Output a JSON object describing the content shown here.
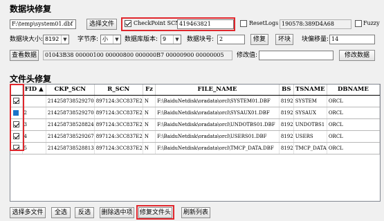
{
  "data_block": {
    "title": "数据块修复",
    "file_path": "F:\\temp\\system01.dbf",
    "select_file_label": "选择文件",
    "checkpoint_scn_label": "CheckPoint SCN",
    "checkpoint_scn_value": "419463821",
    "resetlogs_label": "ResetLogs",
    "resetlogs_value": "190578:389D4A68",
    "fuzzy_label": "Fuzzy",
    "block_size_label": "数据块大小:",
    "block_size_value": "8192",
    "byte_order_label": "字节序:",
    "byte_order_value": "小",
    "db_version_label": "数据库版本:",
    "db_version_value": "9",
    "block_no_label": "数据块号:",
    "block_no_value": "2",
    "repair_label": "修复",
    "bad_block_label": "坏块",
    "block_offset_label": "块偏移量:",
    "block_offset_value": "14",
    "view_data_label": "查看数据",
    "data_hex": "01043B38 00000100 00000800 000000B7 00000900 00000005",
    "modify_value_label": "修改值:",
    "modify_value": "",
    "modify_data_label": "修改数据"
  },
  "file_header": {
    "title": "文件头修复",
    "columns": [
      "FID",
      "CKP_SCN",
      "R_SCN",
      "Fz",
      "FILE_NAME",
      "BS",
      "TSNAME",
      "DBNAME"
    ],
    "rows": [
      {
        "checked": true,
        "fid": "",
        "ckp_scn": "214258738529270",
        "r_scn": "897124:3CC837E2",
        "fz": "N",
        "file_name": "F:\\BaiduNetdisk\\oradata\\orcl\\SYSTEM01.DBF",
        "bs": "8192",
        "tsname": "SYSTEM",
        "dbname": "ORCL"
      },
      {
        "checked": false,
        "fid": "2",
        "ckp_scn": "214258738529270",
        "r_scn": "897124:3CC837E2",
        "fz": "N",
        "file_name": "F:\\BaiduNetdisk\\oradata\\orcl\\SYSAUX01.DBF",
        "bs": "8192",
        "tsname": "SYSAUX",
        "dbname": "ORCL"
      },
      {
        "checked": true,
        "fid": "3",
        "ckp_scn": "214258738528824",
        "r_scn": "897124:3CC837E2",
        "fz": "N",
        "file_name": "F:\\BaiduNetdisk\\oradata\\orcl\\UNDOTBS01.DBF",
        "bs": "8192",
        "tsname": "UNDOTBS1",
        "dbname": "ORCL"
      },
      {
        "checked": true,
        "fid": "4",
        "ckp_scn": "214258738529267",
        "r_scn": "897124:3CC837E2",
        "fz": "N",
        "file_name": "F:\\BaiduNetdisk\\oradata\\orcl\\USERS01.DBF",
        "bs": "8192",
        "tsname": "USERS",
        "dbname": "ORCL"
      },
      {
        "checked": true,
        "fid": "5",
        "ckp_scn": "214258738528813",
        "r_scn": "897124:3CC837E2",
        "fz": "N",
        "file_name": "F:\\BaiduNetdisk\\oradata\\orcl\\TMCP_DATA.DBF",
        "bs": "8192",
        "tsname": "TMCP_DATA",
        "dbname": "ORCL"
      }
    ]
  },
  "bottom_buttons": {
    "select_multi": "选择多文件",
    "select_all": "全选",
    "invert": "反选",
    "delete_selected": "删除选中项",
    "repair_header": "修复文件头",
    "refresh": "刷新列表"
  },
  "colors": {
    "highlight_box": "#e0262c",
    "row_indicator": "#1a73c8"
  }
}
